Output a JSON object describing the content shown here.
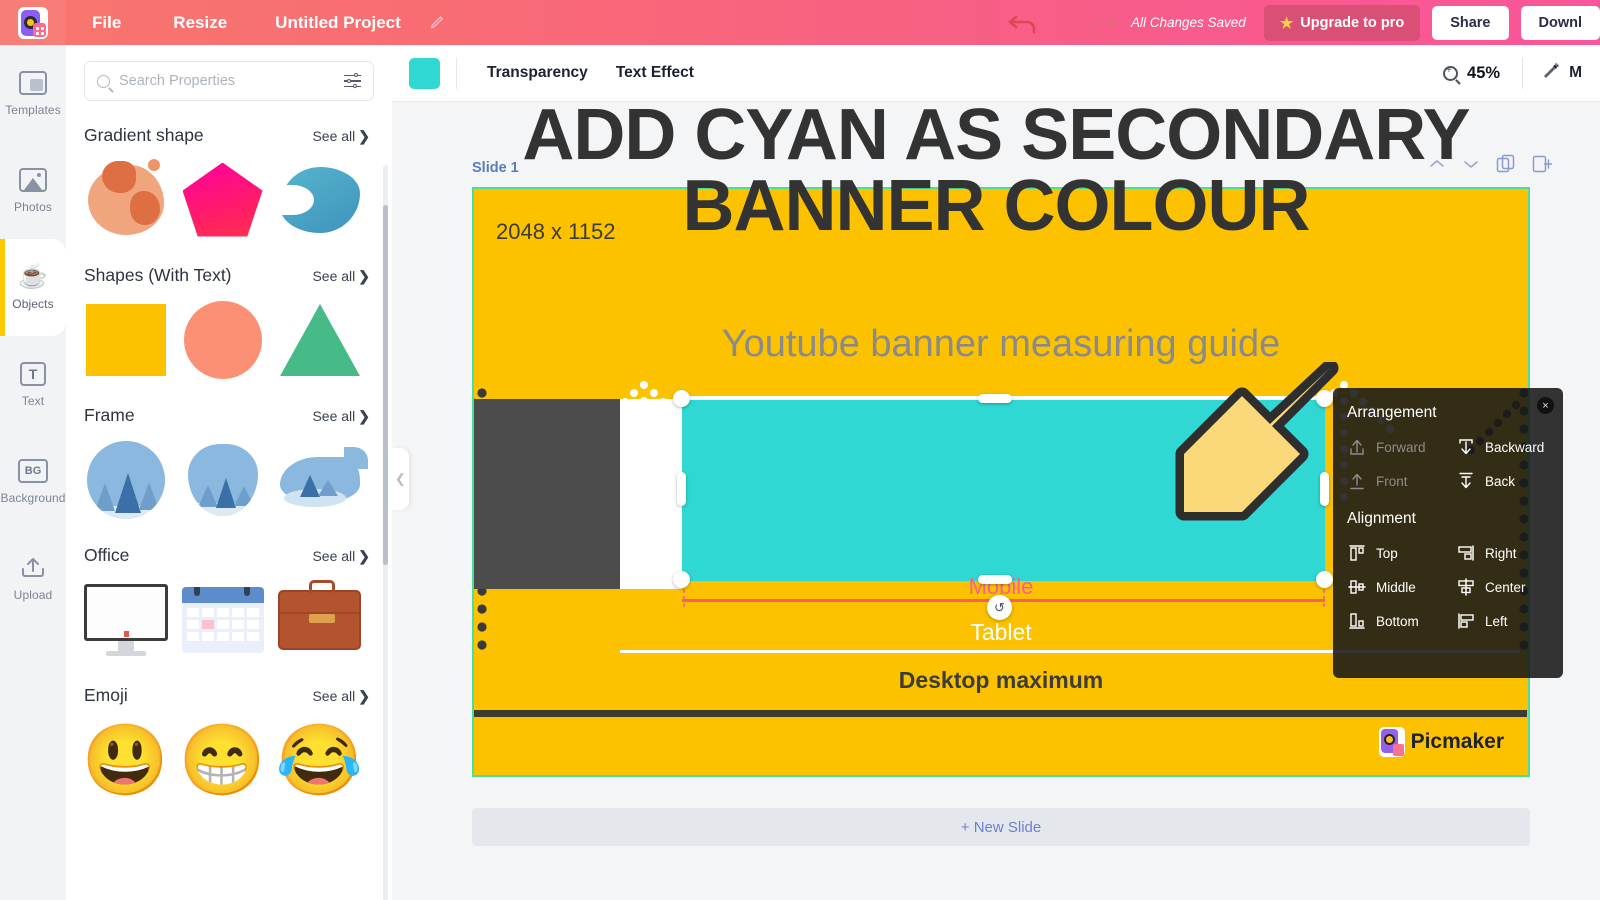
{
  "topbar": {
    "logo": "picmaker-logo",
    "menu": [
      {
        "label": "File",
        "name": "file-menu"
      },
      {
        "label": "Resize",
        "name": "resize-menu"
      }
    ],
    "project_title": "Untitled Project",
    "edit_icon": "pencil-icon",
    "undo_icon": "undo-icon",
    "redo_icon": "redo-icon",
    "save_status": "All Changes Saved",
    "upgrade_label": "Upgrade to pro",
    "upgrade_star": "★",
    "share_label": "Share",
    "download_label": "Downl",
    "accent_pink": "#f9559a",
    "accent_coral": "#f7766e"
  },
  "rail": {
    "items": [
      {
        "label": "Templates",
        "icon": "templates-icon",
        "active": false
      },
      {
        "label": "Photos",
        "icon": "photos-icon",
        "active": false
      },
      {
        "label": "Objects",
        "icon": "objects-cup-icon",
        "active": true
      },
      {
        "label": "Text",
        "icon": "text-icon",
        "active": false
      },
      {
        "label": "Background",
        "icon": "background-icon",
        "active": false
      },
      {
        "label": "Upload",
        "icon": "upload-icon",
        "active": false
      }
    ],
    "active_color": "#ffc800"
  },
  "properties": {
    "search": {
      "placeholder": "Search Properties",
      "value": "",
      "icon": "search-icon",
      "filter_icon": "sliders-icon"
    },
    "see_all_label": "See all",
    "chevron": "❯",
    "sections": [
      {
        "title": "Gradient shape",
        "items": [
          "gradient-blob",
          "gradient-pentagon",
          "gradient-bean"
        ]
      },
      {
        "title": "Shapes (With Text)",
        "items": [
          "yellow-square",
          "salmon-circle",
          "green-triangle"
        ]
      },
      {
        "title": "Frame",
        "items": [
          "forest-circle-frame",
          "apple-frame",
          "whale-frame"
        ]
      },
      {
        "title": "Office",
        "items": [
          "monitor",
          "calendar",
          "briefcase"
        ]
      },
      {
        "title": "Emoji",
        "items": [
          "grinning-face",
          "smiling-eyes-face",
          "tears-of-joy-face"
        ]
      }
    ],
    "emoji_glyphs": [
      "😃",
      "😁",
      "😂"
    ]
  },
  "collapse_handle": {
    "icon": "chevron-left-icon"
  },
  "canvas_toolbar": {
    "color_swatch": "#2fd8d2",
    "buttons": [
      {
        "label": "Transparency",
        "name": "transparency-button"
      },
      {
        "label": "Text Effect",
        "name": "text-effect-button"
      }
    ],
    "zoom_label": "45%",
    "zoom_icon": "zoom-in-icon",
    "magic_label": "M",
    "magic_icon": "magic-wand-icon"
  },
  "canvas": {
    "slide_label": "Slide 1",
    "slide_controls": [
      "chevron-up-icon",
      "chevron-down-icon",
      "duplicate-slide-icon",
      "add-slide-icon"
    ],
    "slide": {
      "background": "#fcc200",
      "border": "#4ade9b",
      "dimension_label": "2048 x 1152",
      "ghost_title": "Youtube banner measuring guide",
      "labels": {
        "mobile": "Mobile",
        "tablet": "Tablet",
        "desktop": "Desktop maximum"
      },
      "label_colors": {
        "mobile": "#fb5f8e",
        "tablet": "#ffffff",
        "desktop": "#3c3c3c"
      },
      "selected_shape_color": "#2fd8d2",
      "dark_block_color": "#4c4c4c",
      "watermark": "Picmaker"
    },
    "overlay_text_line1": "ADD CYAN AS SECONDARY",
    "overlay_text_line2": "BANNER COLOUR",
    "arrow_annotation": "down-left-arrow",
    "rotate_icon": "↺",
    "new_slide_label": "+ New Slide"
  },
  "arrangement": {
    "close_icon": "×",
    "section1_title": "Arrangement",
    "section2_title": "Alignment",
    "arrangement_items": [
      {
        "label": "Forward",
        "icon": "move-forward-icon",
        "disabled": true
      },
      {
        "label": "Backward",
        "icon": "move-backward-icon",
        "disabled": false
      },
      {
        "label": "Front",
        "icon": "bring-to-front-icon",
        "disabled": true
      },
      {
        "label": "Back",
        "icon": "send-to-back-icon",
        "disabled": false
      }
    ],
    "alignment_items": [
      {
        "label": "Top",
        "icon": "align-top-icon"
      },
      {
        "label": "Right",
        "icon": "align-right-icon"
      },
      {
        "label": "Middle",
        "icon": "align-middle-icon"
      },
      {
        "label": "Center",
        "icon": "align-center-icon"
      },
      {
        "label": "Bottom",
        "icon": "align-bottom-icon"
      },
      {
        "label": "Left",
        "icon": "align-left-icon"
      }
    ]
  }
}
